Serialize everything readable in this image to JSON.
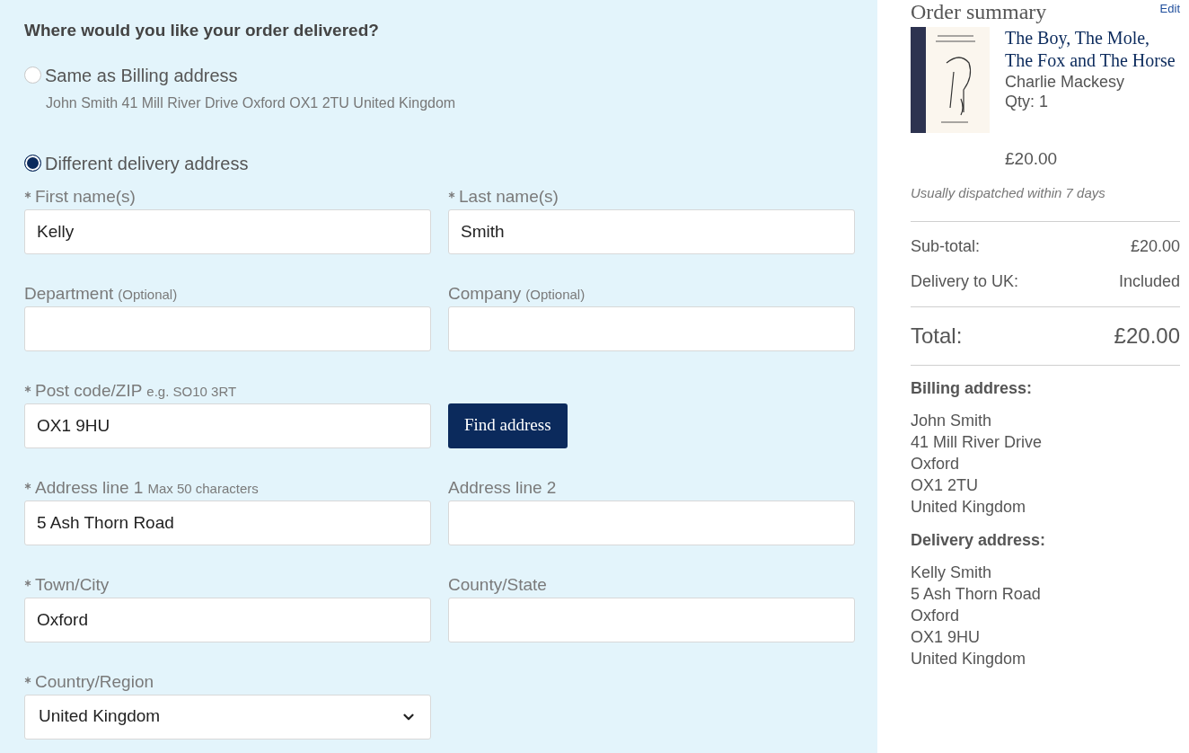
{
  "delivery": {
    "heading": "Where would you like your order delivered?",
    "options": [
      {
        "label": "Same as Billing address",
        "detail": "John Smith 41 Mill River Drive Oxford OX1 2TU United Kingdom",
        "selected": false
      },
      {
        "label": "Different delivery address",
        "selected": true
      }
    ],
    "fields": [
      {
        "kind": "text",
        "label": "First name(s)",
        "required": true,
        "value": "Kelly"
      },
      {
        "kind": "text",
        "label": "Last name(s)",
        "required": true,
        "value": "Smith"
      },
      {
        "kind": "text",
        "label": "Department",
        "hint": "(Optional)",
        "required": false
      },
      {
        "kind": "text",
        "label": "Company",
        "hint": "(Optional)",
        "required": false
      },
      {
        "kind": "text",
        "label": "Post code/ZIP",
        "hint": "e.g. SO10 3RT",
        "required": true,
        "value": "OX1 9HU"
      },
      {
        "kind": "button",
        "label": "Find address"
      },
      {
        "kind": "text",
        "label": "Address line 1",
        "hint": "Max 50 characters",
        "required": true,
        "value": "5 Ash Thorn Road"
      },
      {
        "kind": "text",
        "label": "Address line 2",
        "required": false
      },
      {
        "kind": "text",
        "label": "Town/City",
        "required": true,
        "value": "Oxford"
      },
      {
        "kind": "text",
        "label": "County/State",
        "required": false
      },
      {
        "kind": "select",
        "label": "Country/Region",
        "required": true,
        "value": "United Kingdom"
      }
    ]
  },
  "summary": {
    "title": "Order summary",
    "edit": "Edit",
    "item": {
      "title": "The Boy, The Mole, The Fox and The Horse",
      "author": "Charlie Mackesy",
      "qty": "Qty: 1",
      "price": "£20.00",
      "dispatch": "Usually dispatched within 7 days"
    },
    "lines": [
      {
        "label": "Sub-total:",
        "value": "£20.00"
      },
      {
        "label": "Delivery to UK:",
        "value": "Included"
      }
    ],
    "total": {
      "label": "Total:",
      "value": "£20.00"
    },
    "addresses": [
      {
        "heading": "Billing address:",
        "lines": [
          "John Smith",
          "41 Mill River Drive",
          "Oxford",
          "OX1 2TU",
          "United Kingdom"
        ]
      },
      {
        "heading": "Delivery address:",
        "lines": [
          "Kelly Smith",
          "5 Ash Thorn Road",
          "Oxford",
          "OX1 9HU",
          "United Kingdom"
        ]
      }
    ]
  }
}
